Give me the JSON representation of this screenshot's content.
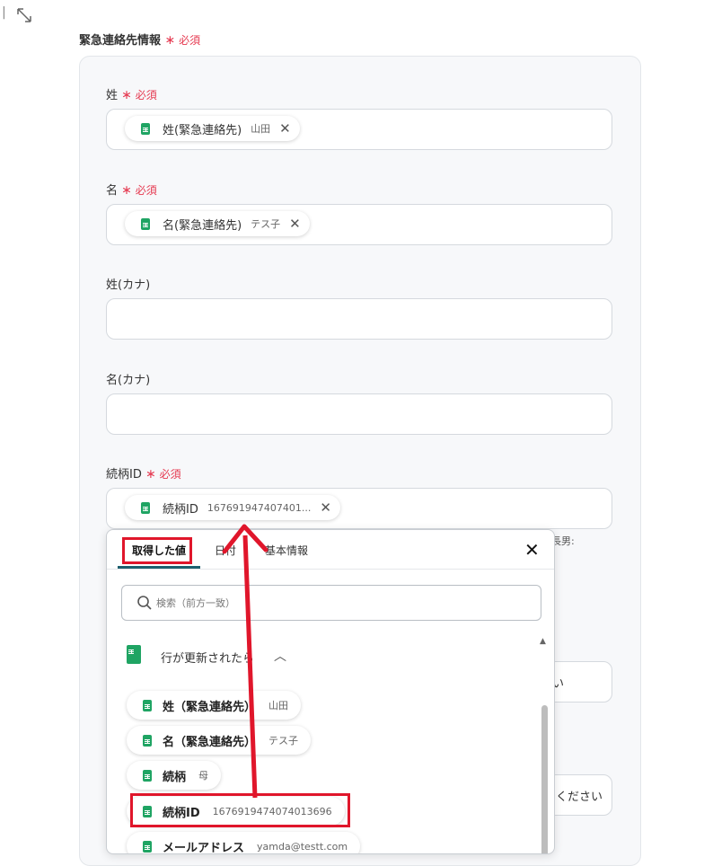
{
  "topbar": {
    "divider": "|",
    "expand_icon": "expand-icon"
  },
  "section": {
    "title": "緊急連絡先情報",
    "required": "必須"
  },
  "fields": {
    "sei": {
      "label": "姓",
      "required": "必須",
      "chip_name": "姓(緊急連絡先)",
      "chip_value": "山田"
    },
    "mei": {
      "label": "名",
      "required": "必須",
      "chip_name": "名(緊急連絡先)",
      "chip_value": "テス子"
    },
    "sei_kana": {
      "label": "姓(カナ)"
    },
    "mei_kana": {
      "label": "名(カナ)"
    },
    "relation_id": {
      "label": "続柄ID",
      "required": "必須",
      "chip_name": "続柄ID",
      "chip_value": "167691947407401..."
    }
  },
  "partial": {
    "hint": "長男:",
    "side_text": "い",
    "button_text": "ください"
  },
  "dropdown": {
    "tabs": [
      "取得した値",
      "日付",
      "基本情報"
    ],
    "active_tab": "取得した値",
    "search_placeholder": "検索（前方一致）",
    "group_title": "行が更新されたら",
    "items": [
      {
        "name": "姓（緊急連絡先）",
        "value": "山田"
      },
      {
        "name": "名（緊急連絡先）",
        "value": "テス子"
      },
      {
        "name": "続柄",
        "value": "母"
      },
      {
        "name": "続柄ID",
        "value": "1676919474074013696"
      },
      {
        "name": "メールアドレス",
        "value": "yamda@testt.com"
      }
    ]
  },
  "colors": {
    "required": "#e53950",
    "accent": "#1fa463",
    "highlight": "#e0162b",
    "tab_underline": "#1d5f6e"
  }
}
